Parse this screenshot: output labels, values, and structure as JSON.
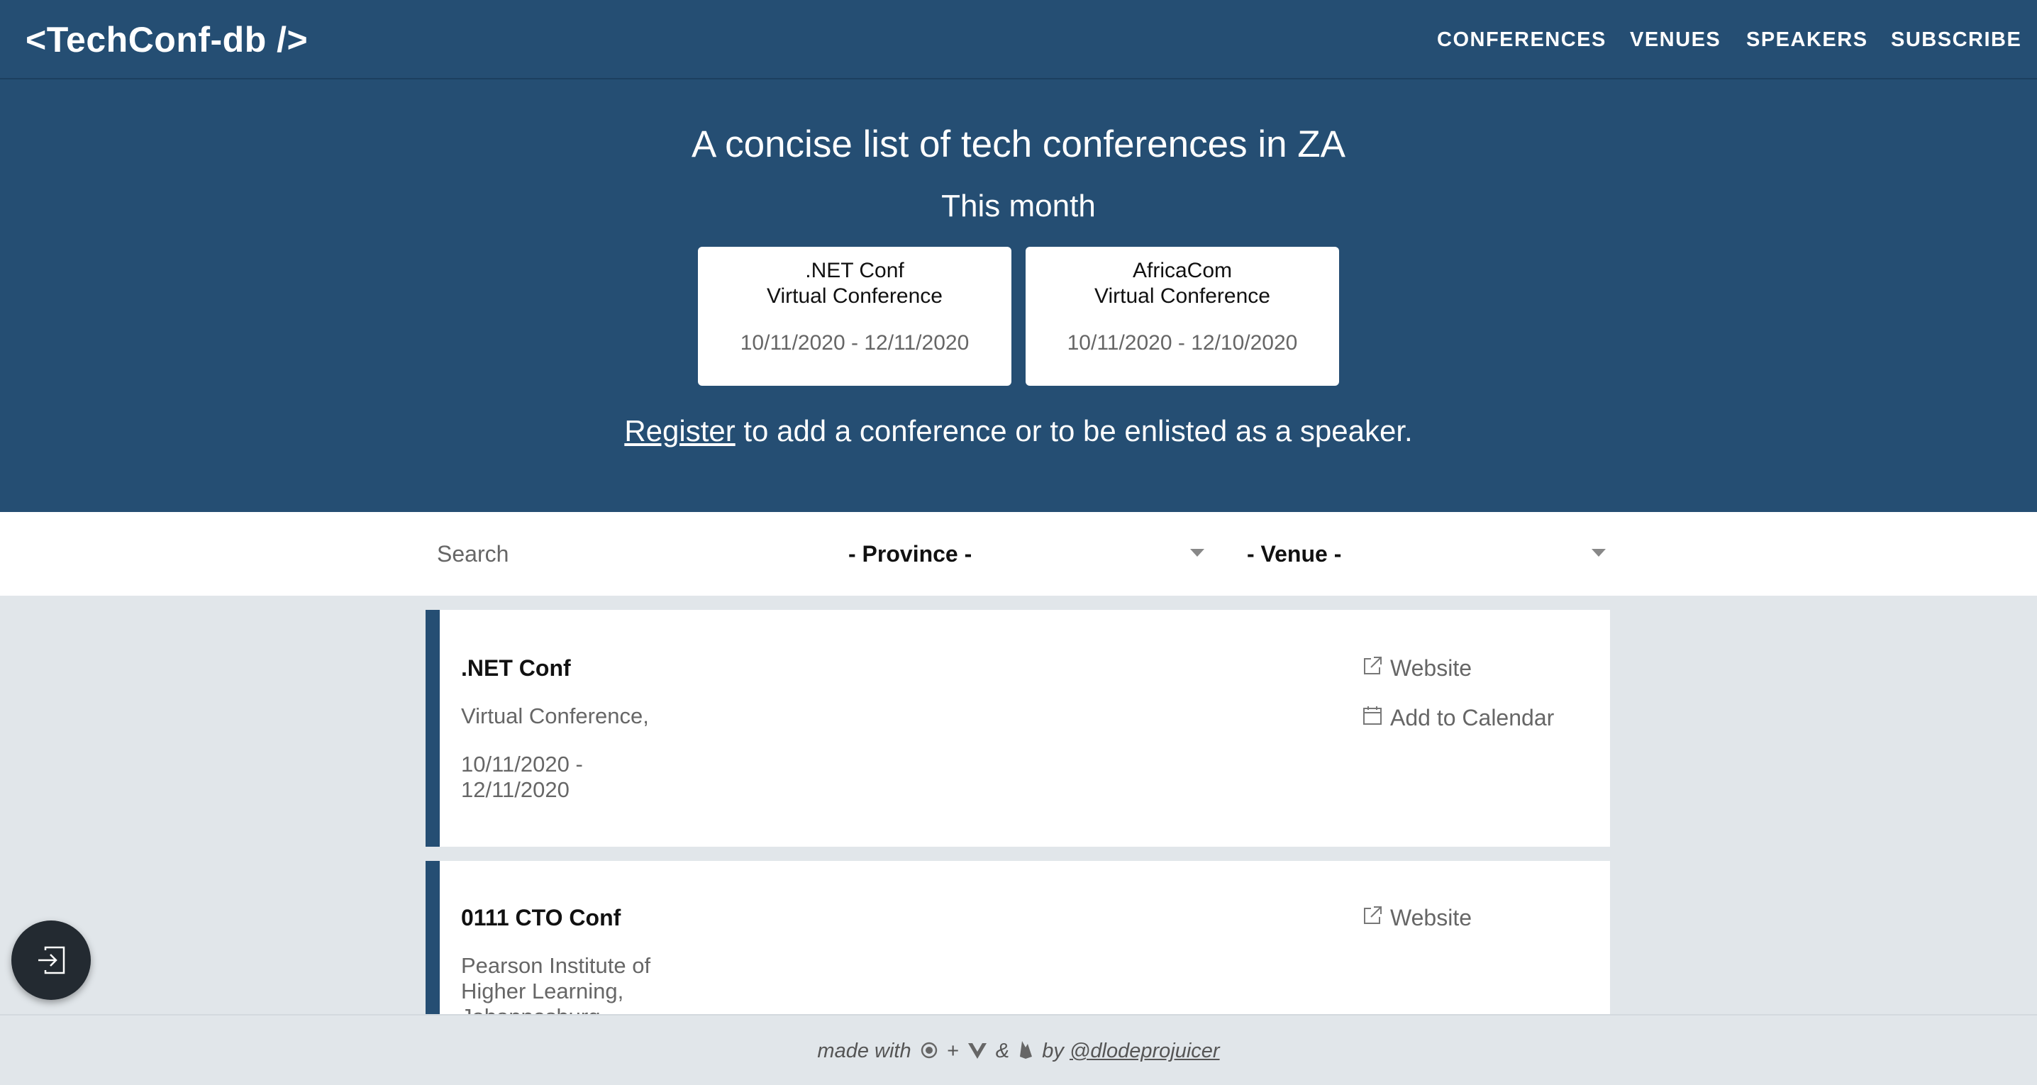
{
  "header": {
    "logo": "<TechConf-db />",
    "nav": [
      "CONFERENCES",
      "VENUES",
      "SPEAKERS",
      "SUBSCRIBE"
    ]
  },
  "hero": {
    "title": "A concise list of tech conferences in ZA",
    "subtitle": "This month",
    "cards": [
      {
        "name": ".NET Conf",
        "location": "Virtual Conference",
        "dates": "10/11/2020 - 12/11/2020"
      },
      {
        "name": "AfricaCom",
        "location": "Virtual Conference",
        "dates": "10/11/2020 - 12/10/2020"
      }
    ],
    "register_link": "Register",
    "register_text": " to add a conference or to be enlisted as a speaker."
  },
  "filters": {
    "search_placeholder": "Search",
    "province": "- Province -",
    "venue": "- Venue -"
  },
  "conferences": [
    {
      "title": ".NET Conf",
      "venue": "Virtual Conference,",
      "dates": "10/11/2020 - 12/11/2020",
      "website_label": "Website",
      "calendar_label": "Add to Calendar"
    },
    {
      "title": "0111 CTO Conf",
      "venue": "Pearson Institute of Higher Learning, Johannesburg",
      "website_label": "Website"
    }
  ],
  "footer": {
    "made_with": "made with",
    "plus": "+",
    "amp": "&",
    "by": "by",
    "author": "@dlodeprojuicer"
  },
  "colors": {
    "primary": "#254e73",
    "background": "#e1e6ea",
    "fab": "#232a31"
  },
  "icons": {
    "website": "external-link-icon",
    "calendar": "calendar-icon",
    "login": "login-icon",
    "footer": [
      "ionic-logo-icon",
      "vue-logo-icon",
      "firebase-logo-icon"
    ]
  }
}
